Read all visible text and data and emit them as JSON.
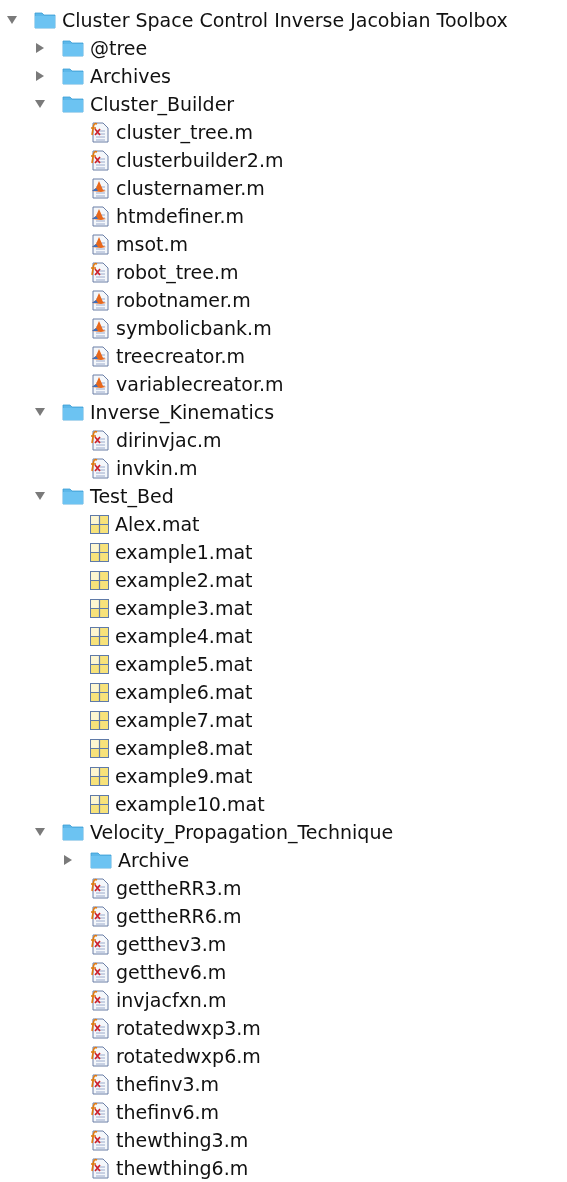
{
  "tree": [
    {
      "kind": "folder",
      "name": "Cluster Space Control Inverse Jacobian Toolbox",
      "expanded": true,
      "children": [
        {
          "kind": "folder",
          "name": "@tree",
          "expanded": false
        },
        {
          "kind": "folder",
          "name": "Archives",
          "expanded": false
        },
        {
          "kind": "folder",
          "name": "Cluster_Builder",
          "expanded": true,
          "children": [
            {
              "kind": "function",
              "name": "cluster_tree.m"
            },
            {
              "kind": "function",
              "name": "clusterbuilder2.m"
            },
            {
              "kind": "script",
              "name": "clusternamer.m"
            },
            {
              "kind": "script",
              "name": "htmdefiner.m"
            },
            {
              "kind": "script",
              "name": "msot.m"
            },
            {
              "kind": "function",
              "name": "robot_tree.m"
            },
            {
              "kind": "script",
              "name": "robotnamer.m"
            },
            {
              "kind": "script",
              "name": "symbolicbank.m"
            },
            {
              "kind": "script",
              "name": "treecreator.m"
            },
            {
              "kind": "script",
              "name": "variablecreator.m"
            }
          ]
        },
        {
          "kind": "folder",
          "name": "Inverse_Kinematics",
          "expanded": true,
          "children": [
            {
              "kind": "function",
              "name": "dirinvjac.m"
            },
            {
              "kind": "function",
              "name": "invkin.m"
            }
          ]
        },
        {
          "kind": "folder",
          "name": "Test_Bed",
          "expanded": true,
          "children": [
            {
              "kind": "mat",
              "name": "Alex.mat"
            },
            {
              "kind": "mat",
              "name": "example1.mat"
            },
            {
              "kind": "mat",
              "name": "example2.mat"
            },
            {
              "kind": "mat",
              "name": "example3.mat"
            },
            {
              "kind": "mat",
              "name": "example4.mat"
            },
            {
              "kind": "mat",
              "name": "example5.mat"
            },
            {
              "kind": "mat",
              "name": "example6.mat"
            },
            {
              "kind": "mat",
              "name": "example7.mat"
            },
            {
              "kind": "mat",
              "name": "example8.mat"
            },
            {
              "kind": "mat",
              "name": "example9.mat"
            },
            {
              "kind": "mat",
              "name": "example10.mat"
            }
          ]
        },
        {
          "kind": "folder",
          "name": "Velocity_Propagation_Technique",
          "expanded": true,
          "children": [
            {
              "kind": "folder",
              "name": "Archive",
              "expanded": false
            },
            {
              "kind": "function",
              "name": "gettheRR3.m"
            },
            {
              "kind": "function",
              "name": "gettheRR6.m"
            },
            {
              "kind": "function",
              "name": "getthev3.m"
            },
            {
              "kind": "function",
              "name": "getthev6.m"
            },
            {
              "kind": "function",
              "name": "invjacfxn.m"
            },
            {
              "kind": "function",
              "name": "rotatedwxp3.m"
            },
            {
              "kind": "function",
              "name": "rotatedwxp6.m"
            },
            {
              "kind": "function",
              "name": "thefinv3.m"
            },
            {
              "kind": "function",
              "name": "thefinv6.m"
            },
            {
              "kind": "function",
              "name": "thewthing3.m"
            },
            {
              "kind": "function",
              "name": "thewthing6.m"
            }
          ]
        }
      ]
    }
  ]
}
